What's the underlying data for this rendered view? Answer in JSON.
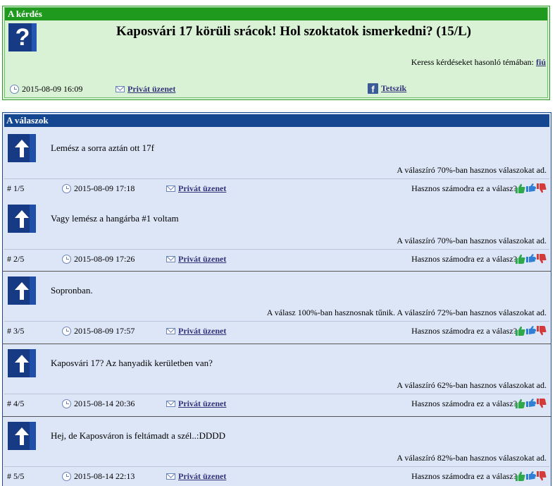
{
  "question": {
    "header": "A kérdés",
    "icon": "question-mark-icon",
    "title": "Kaposvári 17 körüli srácok! Hol szoktatok ismerkedni? (15/L)",
    "similar_label": "Keress kérdéseket hasonló témában:",
    "similar_link": "fiú",
    "date": "2015-08-09 16:09",
    "pm_label": "Privát üzenet",
    "like_label": "Tetszik"
  },
  "answers_header": "A válaszok",
  "helpful_prompt": "Hasznos számodra ez a válasz?",
  "pm_label": "Privát üzenet",
  "colors": {
    "question_bg": "#d9f2d6",
    "question_bar": "#1f9a1f",
    "answers_bg": "#dde6f7",
    "answers_bar": "#154690",
    "thumb_up": "#2ea84a",
    "thumb_neutral": "#2f7fd6",
    "thumb_down": "#d33a3a"
  },
  "answers": [
    {
      "text": "Lemész a sorra aztán ott 17f",
      "info": "A válaszíró 70%-ban hasznos válaszokat ad.",
      "index": "# 1/5",
      "date": "2015-08-09 17:18"
    },
    {
      "text": "Vagy lemész a hangárba #1 voltam",
      "info": "A válaszíró 70%-ban hasznos válaszokat ad.",
      "index": "# 2/5",
      "date": "2015-08-09 17:26"
    },
    {
      "text": "Sopronban.",
      "info": "A válasz 100%-ban hasznosnak tűnik. A válaszíró 72%-ban hasznos válaszokat ad.",
      "index": "# 3/5",
      "date": "2015-08-09 17:57"
    },
    {
      "text": "Kaposvári 17? Az hanyadik kerületben van?",
      "info": "A válaszíró 62%-ban hasznos válaszokat ad.",
      "index": "# 4/5",
      "date": "2015-08-14 20:36"
    },
    {
      "text": "Hej, de Kaposváron is feltámadt a szél..:DDDD",
      "info": "A válaszíró 82%-ban hasznos válaszokat ad.",
      "index": "# 5/5",
      "date": "2015-08-14 22:13"
    }
  ]
}
